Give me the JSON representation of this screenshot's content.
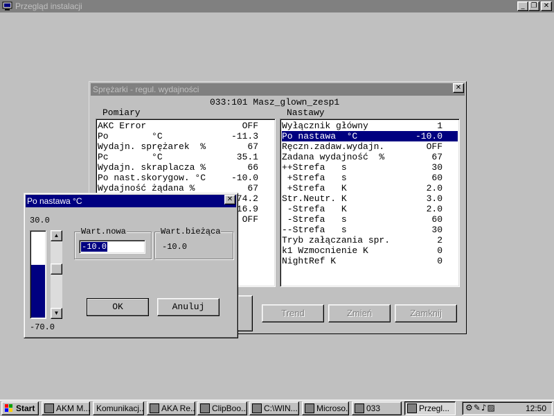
{
  "app": {
    "title": "Przegląd instalacji",
    "minimize": "_",
    "restore": "❐",
    "close": "✕"
  },
  "compressor_window": {
    "title": "Sprężarki - regul. wydajności",
    "address": "033:101  Masz_glown_zesp1",
    "measurements_header": "Pomiary",
    "settings_header": "Nastawy",
    "close": "✕",
    "measurements": [
      {
        "label": "AKC Error",
        "value": "OFF"
      },
      {
        "label": "Po        °C",
        "value": "-11.3"
      },
      {
        "label": "Wydajn. sprężarek  %",
        "value": "67"
      },
      {
        "label": "Pc        °C",
        "value": "35.1"
      },
      {
        "label": "Wydajn. skraplacza %",
        "value": "66"
      },
      {
        "label": "Po nast.skorygow. °C",
        "value": "-10.0"
      },
      {
        "label": "Wydajność żądana %",
        "value": "67"
      },
      {
        "label": "",
        "value": "74.2"
      },
      {
        "label": "",
        "value": "16.9"
      },
      {
        "label": "",
        "value": "OFF"
      }
    ],
    "settings": [
      {
        "label": "Wyłącznik główny",
        "value": "1"
      },
      {
        "label": "Po nastawa  °C",
        "value": "-10.0"
      },
      {
        "label": "Ręczn.zadaw.wydajn.",
        "value": "OFF"
      },
      {
        "label": "Zadana wydajność  %",
        "value": "67"
      },
      {
        "label": "++Strefa   s",
        "value": "30"
      },
      {
        "label": " +Strefa   s",
        "value": "60"
      },
      {
        "label": " +Strefa   K",
        "value": "2.0"
      },
      {
        "label": "Str.Neutr. K",
        "value": "3.0"
      },
      {
        "label": " -Strefa   K",
        "value": "2.0"
      },
      {
        "label": " -Strefa   s",
        "value": "60"
      },
      {
        "label": "--Strefa   s",
        "value": "30"
      },
      {
        "label": "Tryb załączania spr.",
        "value": "2"
      },
      {
        "label": "k1 Wzmocnienie K",
        "value": "0"
      },
      {
        "label": "NightRef K",
        "value": "0"
      }
    ],
    "selected_setting_index": 1,
    "buttons": {
      "trend": "Trend",
      "change": "Zmień",
      "close": "Zamknij"
    }
  },
  "dialog": {
    "title": "Po nastawa  °C",
    "close": "✕",
    "max_value": "30.0",
    "min_value": "-70.0",
    "slider_level_fraction": 0.6,
    "new_value_label": "Wart.nowa",
    "new_value": "-10.0",
    "current_value_label": "Wart.bieżąca",
    "current_value": "-10.0",
    "ok": "OK",
    "cancel": "Anuluj"
  },
  "taskbar": {
    "start": "Start",
    "tasks": [
      {
        "label": "AKM M...",
        "icon": "monitor-icon",
        "active": false
      },
      {
        "label": "Komunikacj...",
        "icon": "",
        "active": false
      },
      {
        "label": "AKA Re...",
        "icon": "grid-icon",
        "active": false
      },
      {
        "label": "ClipBoo...",
        "icon": "clipboard-icon",
        "active": false
      },
      {
        "label": "C:\\WIN...",
        "icon": "folder-icon",
        "active": false
      },
      {
        "label": "Microso...",
        "icon": "word-icon",
        "active": false
      },
      {
        "label": "033",
        "icon": "gear-icon",
        "active": false
      },
      {
        "label": "Przegl...",
        "icon": "app-icon",
        "active": true
      }
    ],
    "clock": "12:50"
  },
  "colors": {
    "selection": "#000080",
    "inactive_title": "#808080",
    "face": "#c0c0c0"
  }
}
